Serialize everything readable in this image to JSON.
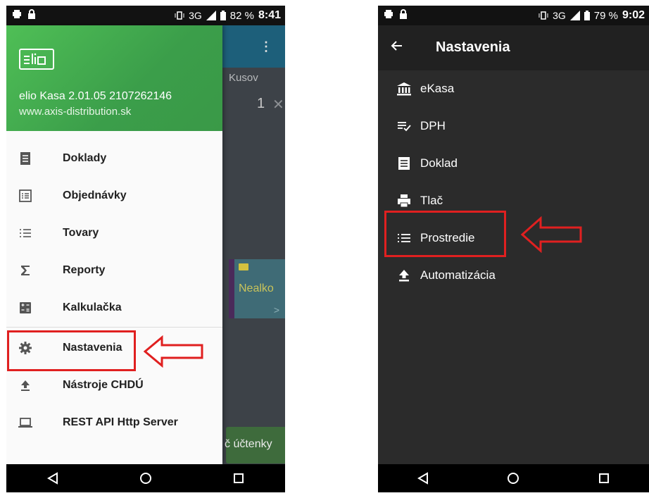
{
  "left_phone": {
    "status": {
      "battery": "82 %",
      "time": "8:41",
      "network": "3G"
    },
    "background_app": {
      "column_header": "Kusov",
      "quantity": "1",
      "tile_label": "Nealko",
      "button_label": "č účtenky"
    },
    "drawer": {
      "version": "elio Kasa 2.01.05 2107262146",
      "website": "www.axis-distribution.sk",
      "items": [
        {
          "label": "Doklady",
          "icon": "receipt-list-icon"
        },
        {
          "label": "Objednávky",
          "icon": "order-list-icon"
        },
        {
          "label": "Tovary",
          "icon": "list-icon"
        },
        {
          "label": "Reporty",
          "icon": "sigma-icon"
        },
        {
          "label": "Kalkulačka",
          "icon": "calculator-icon"
        },
        {
          "label": "Nastavenia",
          "icon": "gear-icon"
        },
        {
          "label": "Nástroje CHDÚ",
          "icon": "upload-icon"
        },
        {
          "label": "REST API Http Server",
          "icon": "laptop-icon"
        }
      ]
    }
  },
  "right_phone": {
    "status": {
      "battery": "79 %",
      "time": "9:02",
      "network": "3G"
    },
    "title": "Nastavenia",
    "items": [
      {
        "label": "eKasa",
        "icon": "bank-icon"
      },
      {
        "label": "DPH",
        "icon": "playlist-check-icon"
      },
      {
        "label": "Doklad",
        "icon": "receipt-icon"
      },
      {
        "label": "Tlač",
        "icon": "printer-icon"
      },
      {
        "label": "Prostredie",
        "icon": "list-icon"
      },
      {
        "label": "Automatizácia",
        "icon": "upload-icon"
      }
    ]
  },
  "colors": {
    "drawer_header": "#43ad4f",
    "highlight": "#e02020",
    "settings_bg": "#2b2b2b"
  }
}
